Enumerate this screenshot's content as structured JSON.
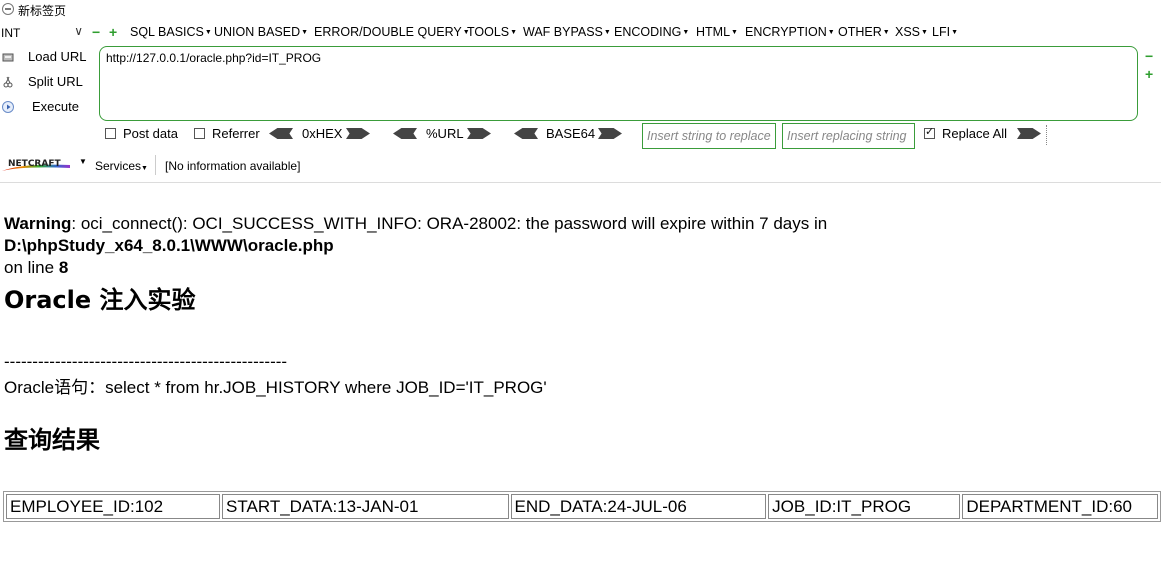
{
  "tab": {
    "title": "新标签页"
  },
  "toolbar": {
    "int_select": "INT",
    "menus": [
      "SQL BASICS",
      "UNION BASED",
      "ERROR/DOUBLE QUERY",
      "TOOLS",
      "WAF BYPASS",
      "ENCODING",
      "HTML",
      "ENCRYPTION",
      "OTHER",
      "XSS",
      "LFI"
    ],
    "load_url": "Load URL",
    "split_url": "Split URL",
    "execute": "Execute",
    "url": "http://127.0.0.1/oracle.php?id=IT_PROG",
    "post_data": "Post data",
    "referrer": "Referrer",
    "hex": "0xHEX",
    "url_enc": "%URL",
    "base64": "BASE64",
    "replace_placeholder": "Insert string to replace",
    "replacing_placeholder": "Insert replacing string",
    "replace_all": "Replace All",
    "replace_all_checked": true
  },
  "netcraft": {
    "logo_text": "NETCRAFT",
    "services": "Services",
    "info": "[No information available]"
  },
  "page": {
    "warning_label": "Warning",
    "warning_text": ": oci_connect(): OCI_SUCCESS_WITH_INFO: ORA-28002: the password will expire within 7 days in ",
    "warning_path": "D:\\phpStudy_x64_8.0.1\\WWW\\oracle.php",
    "warning_online": "on line ",
    "warning_line": "8",
    "title": "Oracle 注入实验",
    "dashes": "--------------------------------------------------",
    "sql": "Oracle语句：select * from hr.JOB_HISTORY where JOB_ID='IT_PROG'",
    "result_title": "查询结果",
    "result_cells": [
      "EMPLOYEE_ID:102",
      "START_DATA:13-JAN-01",
      "END_DATA:24-JUL-06",
      "JOB_ID:IT_PROG",
      "DEPARTMENT_ID:60"
    ]
  }
}
